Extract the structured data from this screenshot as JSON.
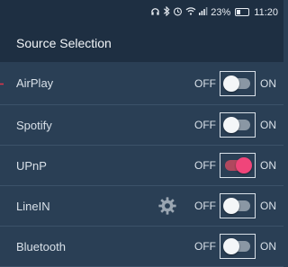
{
  "status_bar": {
    "icons": [
      "headset-icon",
      "bluetooth-icon",
      "alarm-icon",
      "wifi-icon",
      "signal-icon"
    ],
    "battery": "23%",
    "time": "11:20"
  },
  "app_bar": {
    "title": "Source Selection"
  },
  "sources": [
    {
      "label": "AirPlay",
      "off_label": "OFF",
      "on_label": "ON",
      "enabled": false,
      "has_settings": false
    },
    {
      "label": "Spotify",
      "off_label": "OFF",
      "on_label": "ON",
      "enabled": false,
      "has_settings": false
    },
    {
      "label": "UPnP",
      "off_label": "OFF",
      "on_label": "ON",
      "enabled": true,
      "has_settings": false
    },
    {
      "label": "LineIN",
      "off_label": "OFF",
      "on_label": "ON",
      "enabled": false,
      "has_settings": true
    },
    {
      "label": "Bluetooth",
      "off_label": "OFF",
      "on_label": "ON",
      "enabled": false,
      "has_settings": false
    }
  ],
  "colors": {
    "background": "#2a3f55",
    "header": "#1e2f42",
    "accent_on": "#f0457a",
    "marker": "#e0334a"
  }
}
